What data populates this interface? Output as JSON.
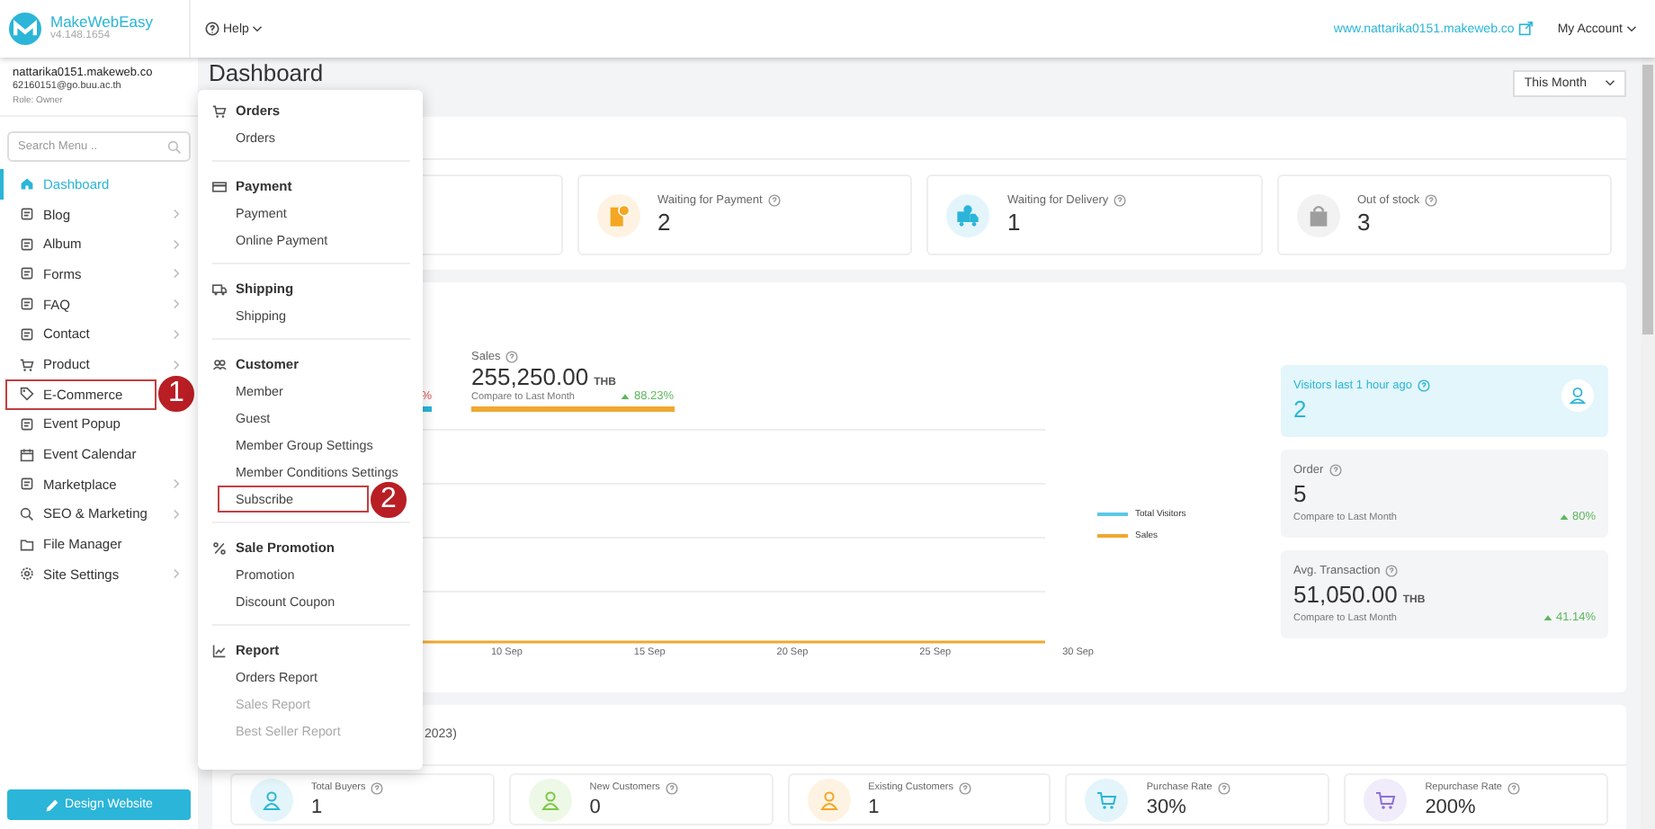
{
  "header": {
    "brand": "MakeWebEasy",
    "version": "v4.148.1654",
    "help": "Help",
    "site_link": "www.nattarika0151.makeweb.co",
    "account": "My Account"
  },
  "user": {
    "domain": "nattarika0151.makeweb.co",
    "email": "62160151@go.buu.ac.th",
    "role": "Role: Owner"
  },
  "search": {
    "placeholder": "Search Menu .."
  },
  "sidebar": {
    "items": [
      {
        "label": "Dashboard",
        "selected": true,
        "has_children": false,
        "highlighted": false
      },
      {
        "label": "Blog",
        "selected": false,
        "has_children": true,
        "highlighted": false
      },
      {
        "label": "Album",
        "selected": false,
        "has_children": true,
        "highlighted": false
      },
      {
        "label": "Forms",
        "selected": false,
        "has_children": true,
        "highlighted": false
      },
      {
        "label": "FAQ",
        "selected": false,
        "has_children": true,
        "highlighted": false
      },
      {
        "label": "Contact",
        "selected": false,
        "has_children": true,
        "highlighted": false
      },
      {
        "label": "Product",
        "selected": false,
        "has_children": true,
        "highlighted": false
      },
      {
        "label": "E-Commerce",
        "selected": false,
        "has_children": false,
        "highlighted": true,
        "badge": "1"
      },
      {
        "label": "Event Popup",
        "selected": false,
        "has_children": false,
        "highlighted": false
      },
      {
        "label": "Event Calendar",
        "selected": false,
        "has_children": false,
        "highlighted": false
      },
      {
        "label": "Marketplace",
        "selected": false,
        "has_children": true,
        "highlighted": false
      },
      {
        "label": "SEO & Marketing",
        "selected": false,
        "has_children": true,
        "highlighted": false
      },
      {
        "label": "File Manager",
        "selected": false,
        "has_children": false,
        "highlighted": false
      },
      {
        "label": "Site Settings",
        "selected": false,
        "has_children": true,
        "highlighted": false
      }
    ]
  },
  "design_button": "Design Website",
  "page": {
    "title": "Dashboard",
    "period": "This Month"
  },
  "order_stats": [
    {
      "label": "Waiting for Payment",
      "value": "2",
      "color": "#f5a623"
    },
    {
      "label": "Waiting for Delivery",
      "value": "1",
      "color": "#2bb5d8"
    },
    {
      "label": "Out of stock",
      "value": "3",
      "color": "#9e9e9e"
    }
  ],
  "chart": {
    "tabs": [
      {
        "change": "%",
        "increase": false,
        "color": "#2bb5d8"
      },
      {
        "label": "Sales",
        "value": "255,250.00",
        "unit": "THB",
        "compare": "Compare to Last Month",
        "change": "88.23%",
        "increase": true,
        "color": "#f0a830"
      }
    ],
    "x_labels": [
      "10 Sep",
      "15 Sep",
      "20 Sep",
      "25 Sep",
      "30 Sep"
    ],
    "legend": [
      {
        "name": "Total Visitors",
        "color": "#5bc8e8"
      },
      {
        "name": "Sales",
        "color": "#f0a830"
      }
    ]
  },
  "side_stats": [
    {
      "kind": "highlight",
      "label": "Visitors last 1 hour ago",
      "value": "2"
    },
    {
      "kind": "compare",
      "label": "Order",
      "value": "5",
      "compare": "Compare to Last Month",
      "change": "80%",
      "increase": true
    },
    {
      "kind": "compare",
      "label": "Avg. Transaction",
      "value": "51,050.00",
      "unit": "THB",
      "compare": "Compare to Last Month",
      "change": "41.14%",
      "increase": true
    }
  ],
  "customers": {
    "title_fragment": "2023)",
    "cards": [
      {
        "label": "Total Buyers",
        "value": "1",
        "color": "#2bb5d8"
      },
      {
        "label": "New Customers",
        "value": "0",
        "color": "#7ac943"
      },
      {
        "label": "Existing Customers",
        "value": "1",
        "color": "#f5a623"
      },
      {
        "label": "Purchase Rate",
        "value": "30%",
        "color": "#2bb5d8"
      },
      {
        "label": "Repurchase Rate",
        "value": "200%",
        "color": "#8e6fd8"
      }
    ]
  },
  "menu": {
    "sections": [
      {
        "title": "Orders",
        "items": [
          {
            "label": "Orders",
            "highlighted": false,
            "faded": false
          }
        ]
      },
      {
        "title": "Payment",
        "items": [
          {
            "label": "Payment",
            "highlighted": false,
            "faded": false
          },
          {
            "label": "Online Payment",
            "highlighted": false,
            "faded": false
          }
        ]
      },
      {
        "title": "Shipping",
        "items": [
          {
            "label": "Shipping",
            "highlighted": false,
            "faded": false
          }
        ]
      },
      {
        "title": "Customer",
        "items": [
          {
            "label": "Member",
            "highlighted": false,
            "faded": false
          },
          {
            "label": "Guest",
            "highlighted": false,
            "faded": false
          },
          {
            "label": "Member Group Settings",
            "highlighted": false,
            "faded": false
          },
          {
            "label": "Member Conditions Settings",
            "highlighted": false,
            "faded": false
          },
          {
            "label": "Subscribe",
            "highlighted": true,
            "faded": false,
            "badge": "2"
          }
        ]
      },
      {
        "title": "Sale Promotion",
        "items": [
          {
            "label": "Promotion",
            "highlighted": false,
            "faded": false
          },
          {
            "label": "Discount Coupon",
            "highlighted": false,
            "faded": false
          }
        ]
      },
      {
        "title": "Report",
        "items": [
          {
            "label": "Orders Report",
            "highlighted": false,
            "faded": false
          },
          {
            "label": "Sales Report",
            "highlighted": false,
            "faded": true
          },
          {
            "label": "Best Seller Report",
            "highlighted": false,
            "faded": true
          }
        ]
      }
    ]
  }
}
